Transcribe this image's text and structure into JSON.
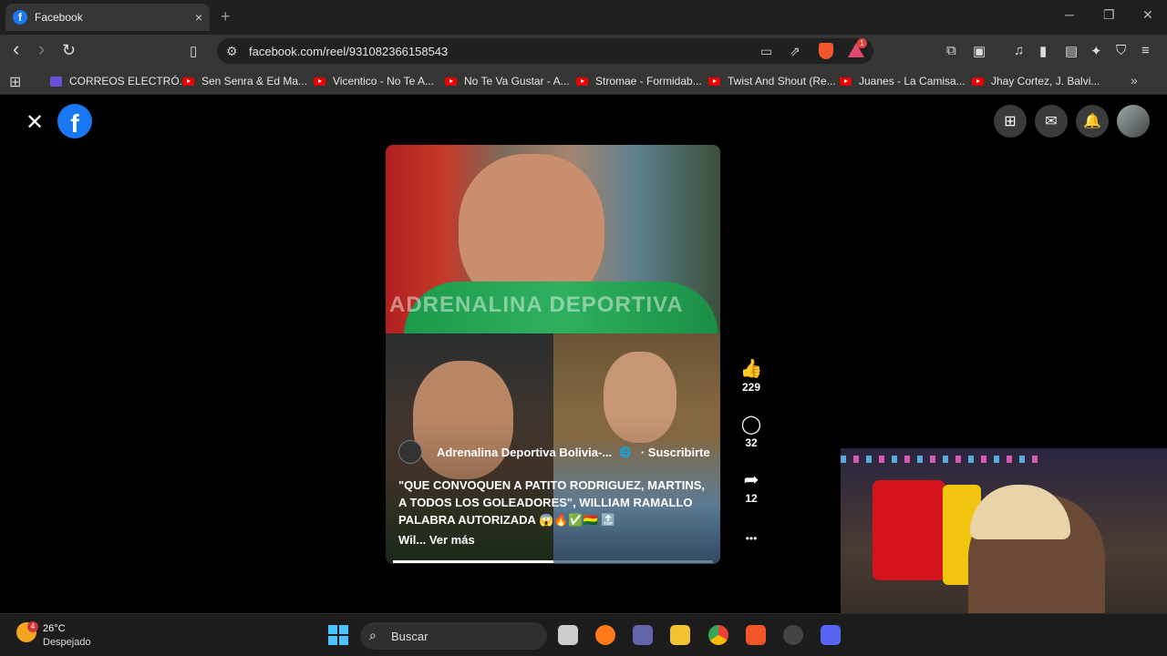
{
  "browser": {
    "tab_title": "Facebook",
    "tab_close": "×",
    "new_tab": "+",
    "url": "facebook.com/reel/931082366158543",
    "alert_count": "1",
    "window_controls": {
      "minimize": "─",
      "maximize": "❐",
      "close": "✕"
    },
    "nav": {
      "back": "‹",
      "forward": "›",
      "reload": "↻"
    }
  },
  "bookmarks": [
    {
      "label": "CORREOS ELECTRÓ...",
      "type": "mail"
    },
    {
      "label": "Sen Senra & Ed Ma...",
      "type": "youtube"
    },
    {
      "label": "Vicentico - No Te A...",
      "type": "youtube"
    },
    {
      "label": "No Te Va Gustar - A...",
      "type": "youtube"
    },
    {
      "label": "Stromae - Formidab...",
      "type": "youtube"
    },
    {
      "label": "Twist And Shout (Re...",
      "type": "youtube"
    },
    {
      "label": "Juanes - La Camisa...",
      "type": "youtube"
    },
    {
      "label": "Jhay Cortez, J. Balvi...",
      "type": "youtube"
    }
  ],
  "facebook": {
    "close": "✕",
    "logo": "f",
    "reel": {
      "watermark": "ADRENALINA DEPORTIVA",
      "author": "Adrenalina Deportiva Bolivia-...",
      "globe": "🌐",
      "subscribe": "· Suscribirte",
      "caption": "\"QUE CONVOQUEN A PATITO RODRIGUEZ, MARTINS, A TODOS LOS GOLEADORES\", WILLIAM RAMALLO PALABRA AUTORIZADA 😱🔥✅🇧🇴 🔝",
      "see_more": "Wil... Ver más",
      "progress": 0.5
    },
    "actions": {
      "likes": "229",
      "comments": "32",
      "shares": "12",
      "more": "•••"
    }
  },
  "taskbar": {
    "temperature": "26°C",
    "condition": "Despejado",
    "weather_badge": "4",
    "search_placeholder": "Buscar"
  },
  "colors": {
    "facebook_blue": "#1877f2",
    "chrome_dark": "#353535",
    "taskbar": "#1c1c1c"
  }
}
